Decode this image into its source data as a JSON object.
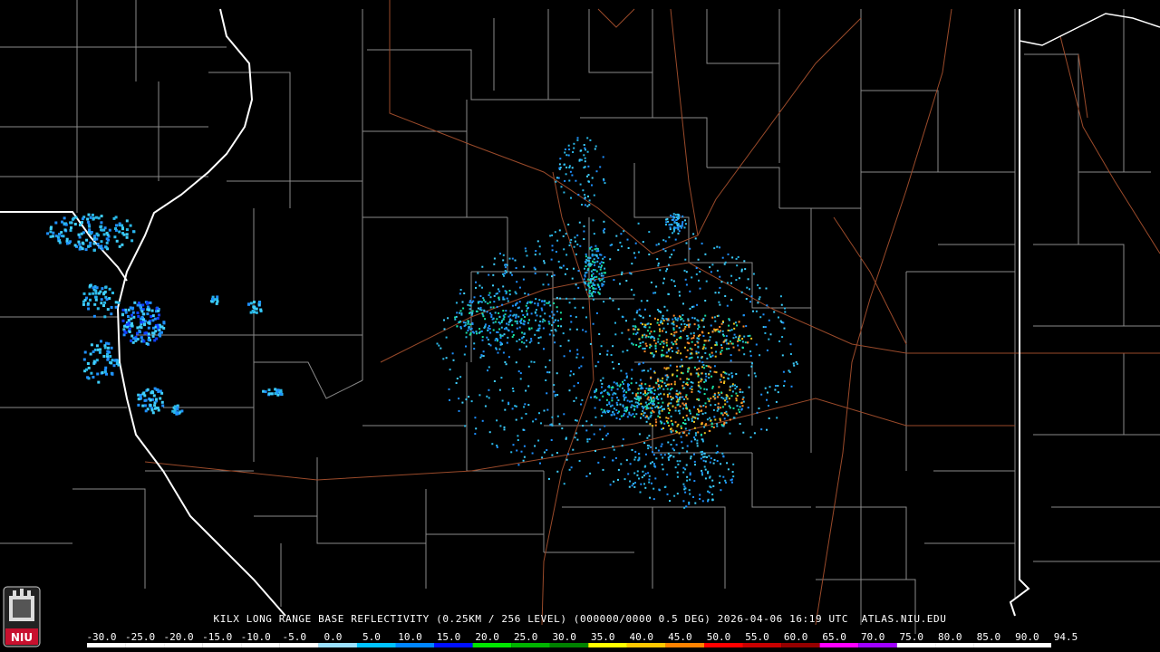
{
  "caption": "KILX LONG RANGE BASE REFLECTIVITY (0.25KM / 256 LEVEL) (000000/0000 0.5 DEG) 2026-04-06 16:19 UTC  ATLAS.NIU.EDU",
  "logo": {
    "text": "NIU",
    "color": "#c8102e"
  },
  "scale": {
    "labels": [
      "-30.0",
      "-25.0",
      "-20.0",
      "-15.0",
      "-10.0",
      "-5.0",
      "0.0",
      "5.0",
      "10.0",
      "15.0",
      "20.0",
      "25.0",
      "30.0",
      "35.0",
      "40.0",
      "45.0",
      "50.0",
      "55.0",
      "60.0",
      "65.0",
      "70.0",
      "75.0",
      "80.0",
      "85.0",
      "90.0",
      "94.5"
    ],
    "colors": [
      "#ffffff",
      "#ffffff",
      "#ffffff",
      "#ffffff",
      "#ffffff",
      "#ffffff",
      "#9be1ff",
      "#00c3ff",
      "#0086ff",
      "#0010ff",
      "#00e600",
      "#00b400",
      "#008200",
      "#ffff00",
      "#ffc800",
      "#ff8200",
      "#ff0000",
      "#c80000",
      "#960000",
      "#ff00ff",
      "#a000ff",
      "#ffffff",
      "#ffffff",
      "#ffffff",
      "#ffffff",
      "#ffffff"
    ]
  },
  "map_colors": {
    "state_border": "#ffffff",
    "county_border": "#8a8a8a",
    "highway": "#9a4a2a",
    "echo_light": "#2ab8e8",
    "echo_mid": "#18e0a0",
    "echo_strong": "#e8c020"
  }
}
